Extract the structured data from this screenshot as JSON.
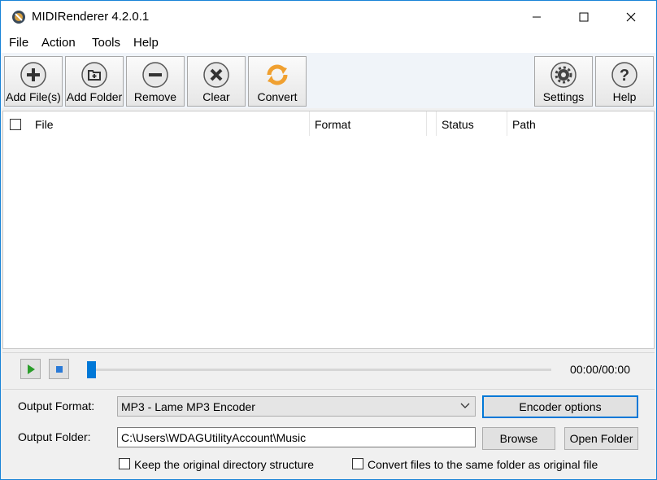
{
  "window": {
    "title": "MIDIRenderer 4.2.0.1"
  },
  "menu": [
    "File",
    "Action",
    "Tools",
    "Help"
  ],
  "toolbar": {
    "add_files": "Add File(s)",
    "add_folder": "Add Folder",
    "remove": "Remove",
    "clear": "Clear",
    "convert": "Convert",
    "settings": "Settings",
    "help": "Help"
  },
  "list": {
    "columns": [
      "File",
      "Format",
      "Status",
      "Path"
    ],
    "rows": []
  },
  "player": {
    "time": "00:00/00:00",
    "progress": 0
  },
  "output": {
    "format_label": "Output Format:",
    "format_value": "MP3 - Lame MP3 Encoder",
    "encoder_options": "Encoder options",
    "folder_label": "Output Folder:",
    "folder_value": "C:\\Users\\WDAGUtilityAccount\\Music",
    "browse": "Browse",
    "open_folder": "Open Folder",
    "keep_structure": "Keep the original directory structure",
    "same_folder": "Convert files to the same folder as original file"
  },
  "colors": {
    "accent": "#0078d7",
    "convert_icon": "#f0a030",
    "play_icon": "#2a9d2a"
  }
}
